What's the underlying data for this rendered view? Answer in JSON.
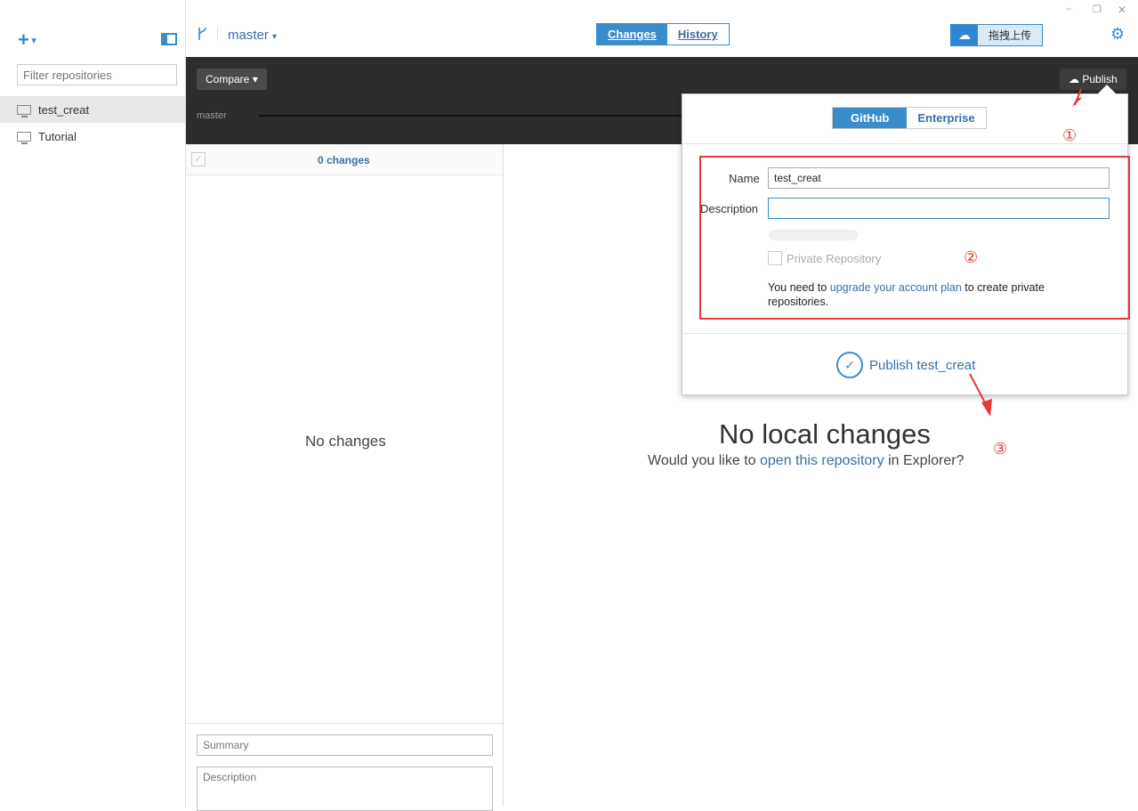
{
  "window": {
    "minimize": "–",
    "maximize": "❐",
    "close": "✕"
  },
  "sidebar": {
    "add_label": "+",
    "filter_placeholder": "Filter repositories",
    "repos": [
      {
        "name": "test_creat"
      },
      {
        "name": "Tutorial"
      }
    ]
  },
  "header": {
    "branch": "master",
    "tabs": [
      {
        "label": "Changes"
      },
      {
        "label": "History"
      }
    ],
    "upload_label": "拖拽上传"
  },
  "toolbar": {
    "compare_label": "Compare",
    "publish_label": "Publish",
    "timeline_branch": "master"
  },
  "changes": {
    "count_label": "0 changes",
    "empty_label": "No changes",
    "summary_placeholder": "Summary",
    "description_placeholder": "Description"
  },
  "main": {
    "title": "No local changes",
    "prompt_before": "Would you like to",
    "prompt_link": "open this repository",
    "prompt_after": "in Explorer?"
  },
  "publish": {
    "tabs": [
      {
        "label": "GitHub"
      },
      {
        "label": "Enterprise"
      }
    ],
    "name_label": "Name",
    "name_value": "test_creat",
    "description_label": "Description",
    "private_label": "Private Repository",
    "note_before": "You need to",
    "note_link": "upgrade your account plan",
    "note_after": "to create private repositories.",
    "submit_label": "Publish test_creat"
  },
  "annotations": {
    "one": "①",
    "two": "②",
    "three": "③"
  },
  "colors": {
    "accent": "#3a8ccb",
    "annotation": "#e53935"
  }
}
